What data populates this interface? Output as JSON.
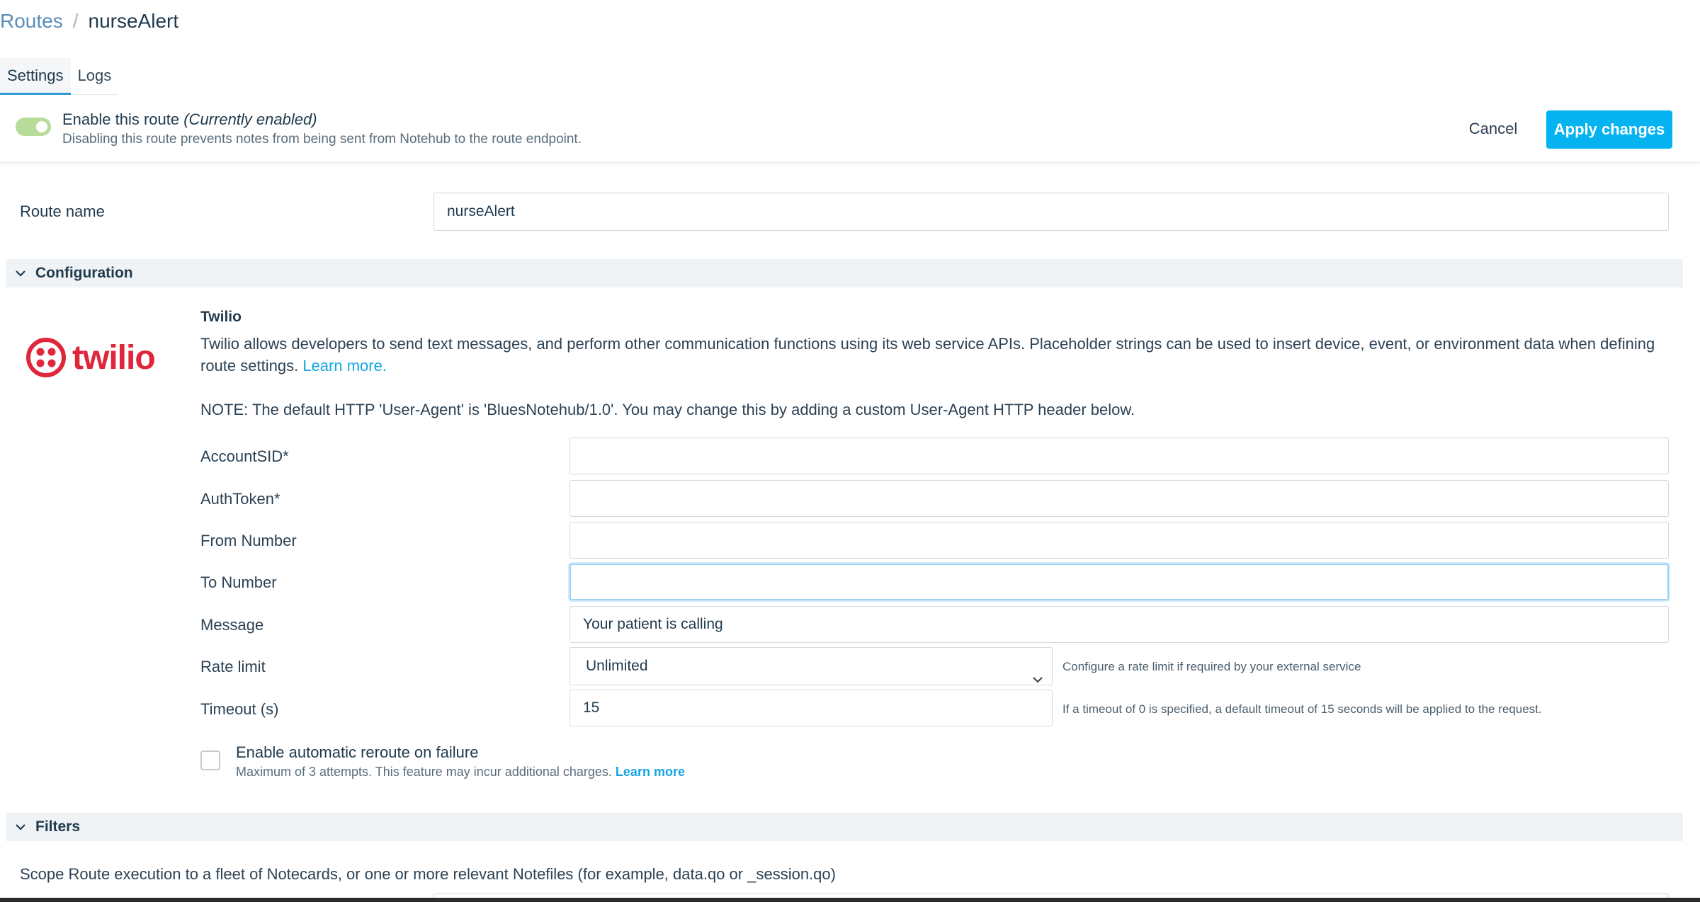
{
  "breadcrumb": {
    "parent": "Routes",
    "separator": "/",
    "current": "nurseAlert"
  },
  "tabs": [
    {
      "label": "Settings",
      "active": true
    },
    {
      "label": "Logs",
      "active": false
    }
  ],
  "enable": {
    "title": "Enable this route ",
    "status": "(Currently enabled)",
    "description": "Disabling this route prevents notes from being sent from Notehub to the route endpoint.",
    "enabled": true
  },
  "actions": {
    "cancel_label": "Cancel",
    "apply_label": "Apply changes"
  },
  "route_name": {
    "label": "Route name",
    "value": "nurseAlert"
  },
  "configuration": {
    "header": "Configuration",
    "provider_logo_text": "twilio",
    "provider_title": "Twilio",
    "description": "Twilio allows developers to send text messages, and perform other communication functions using its web service APIs. Placeholder strings can be used to insert device, event, or environment data when defining route settings.",
    "learn_more": "Learn more.",
    "note": "NOTE: The default HTTP 'User-Agent' is 'BluesNotehub/1.0'. You may change this by adding a custom User-Agent HTTP header below.",
    "fields": {
      "account_sid": {
        "label": "AccountSID*",
        "value": ""
      },
      "auth_token": {
        "label": "AuthToken*",
        "value": ""
      },
      "from_number": {
        "label": "From Number",
        "value": ""
      },
      "to_number": {
        "label": "To Number",
        "value": ""
      },
      "message": {
        "label": "Message",
        "value": "Your patient is calling"
      },
      "rate_limit": {
        "label": "Rate limit",
        "value": "Unlimited",
        "help": "Configure a rate limit if required by your external service"
      },
      "timeout": {
        "label": "Timeout (s)",
        "value": "15",
        "help": "If a timeout of 0 is specified, a default timeout of 15 seconds will be applied to the request."
      }
    },
    "reroute": {
      "title": "Enable automatic reroute on failure",
      "description": "Maximum of 3 attempts. This feature may incur additional charges.",
      "learn_more": "Learn more",
      "checked": false
    }
  },
  "filters": {
    "header": "Filters",
    "description": "Scope Route execution to a fleet of Notecards, or one or more relevant Notefiles (for example, data.qo or _session.qo)"
  },
  "colors": {
    "accent": "#05b3f0",
    "toggle_on": "#b7dc99",
    "twilio_red": "#e0263b",
    "link": "#12a5e6"
  }
}
